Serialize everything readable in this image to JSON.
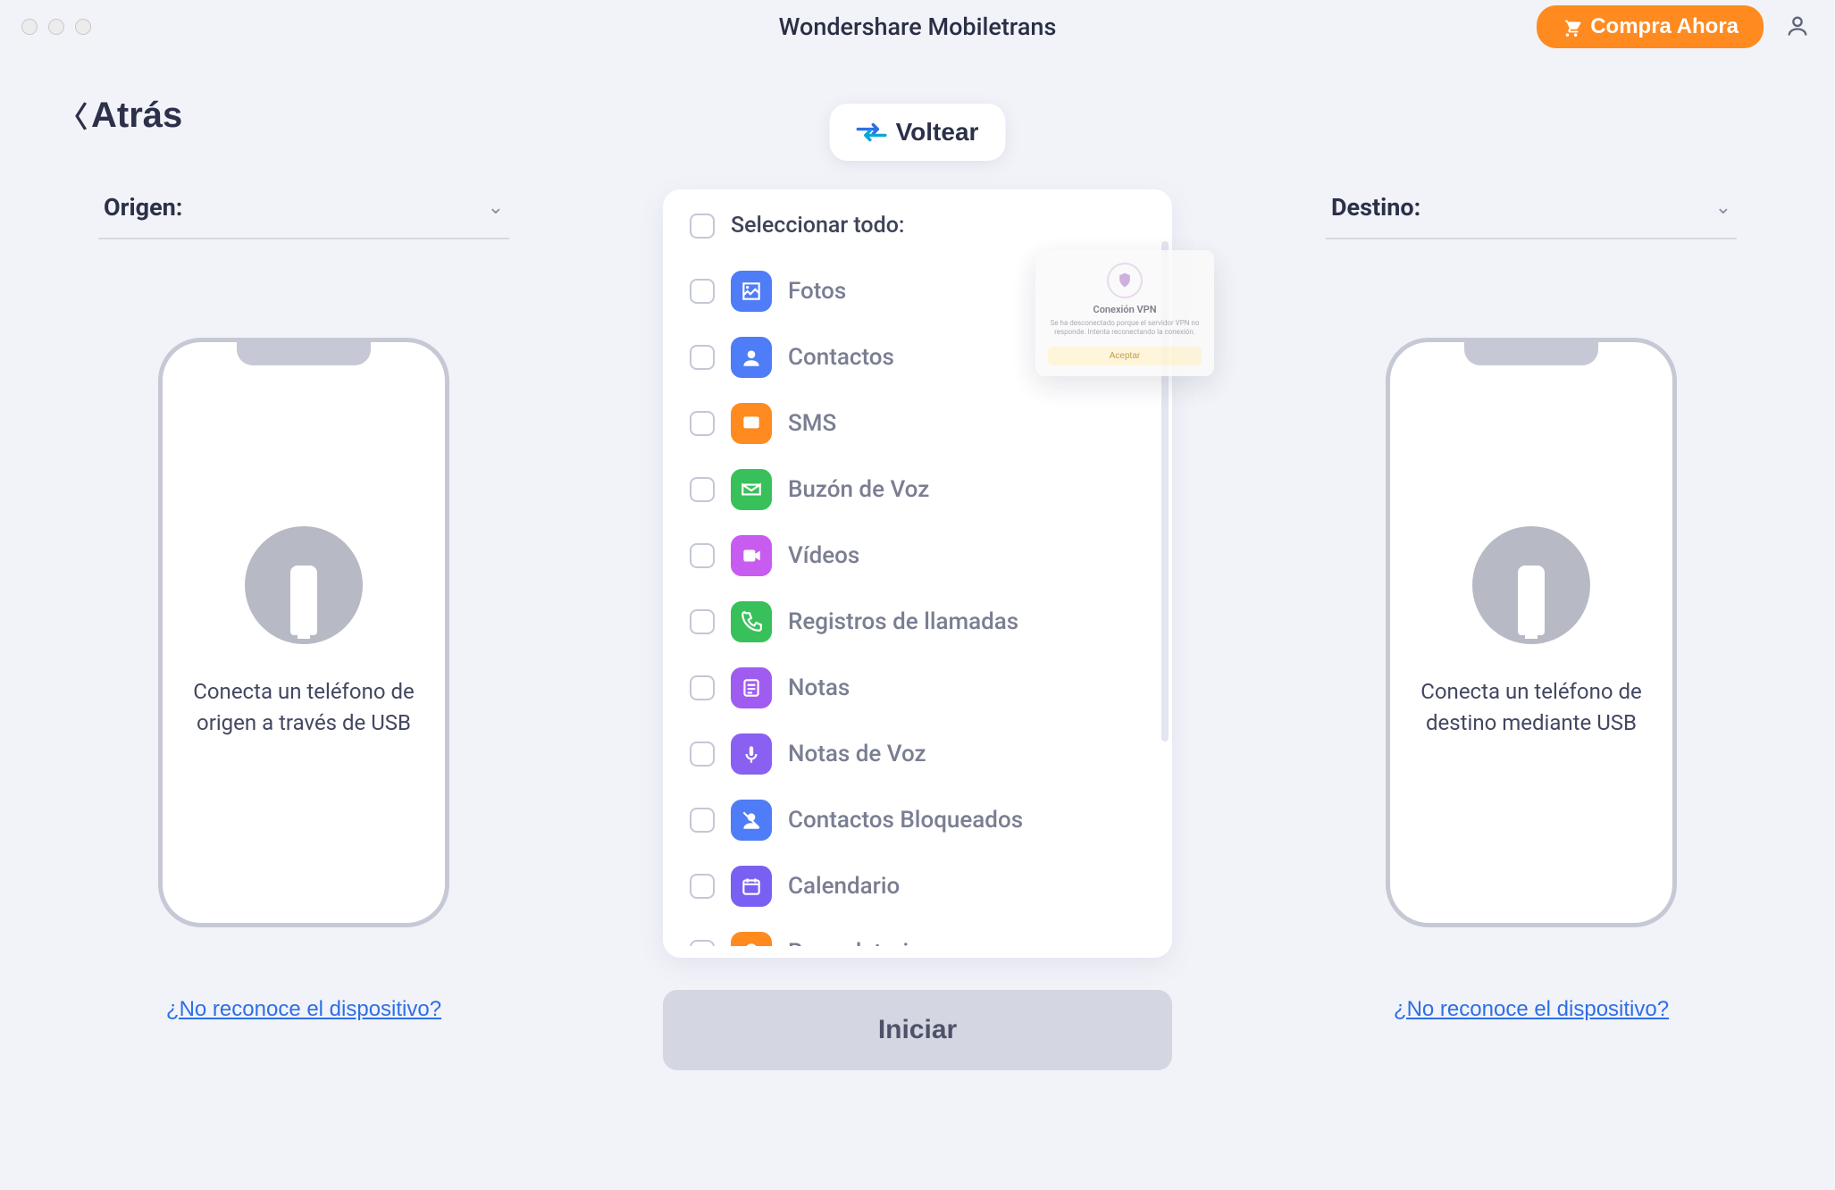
{
  "window": {
    "title": "Wondershare Mobiletrans"
  },
  "header": {
    "buy_label": "Compra Ahora",
    "back_label": "Atrás",
    "flip_label": "Voltear"
  },
  "source": {
    "section_label": "Origen:",
    "hint": "Conecta un teléfono de origen a través de USB",
    "not_recognized": "¿No reconoce el dispositivo?"
  },
  "destination": {
    "section_label": "Destino:",
    "hint": "Conecta un teléfono de destino mediante USB",
    "not_recognized": "¿No reconoce el dispositivo?"
  },
  "data_panel": {
    "select_all_label": "Seleccionar todo:",
    "items": [
      {
        "id": "photos",
        "label": "Fotos",
        "color": "#4f7cf7"
      },
      {
        "id": "contacts",
        "label": "Contactos",
        "color": "#4f7cf7"
      },
      {
        "id": "sms",
        "label": "SMS",
        "color": "#ff8a1f"
      },
      {
        "id": "voicemail",
        "label": "Buzón de Voz",
        "color": "#38c15a"
      },
      {
        "id": "videos",
        "label": "Vídeos",
        "color": "#c85cf0"
      },
      {
        "id": "call-logs",
        "label": "Registros de llamadas",
        "color": "#38c15a"
      },
      {
        "id": "notes",
        "label": "Notas",
        "color": "#a05cf0"
      },
      {
        "id": "voice-notes",
        "label": "Notas de Voz",
        "color": "#8a60f2"
      },
      {
        "id": "blocked-contacts",
        "label": "Contactos Bloqueados",
        "color": "#4f7cf7"
      },
      {
        "id": "calendar",
        "label": "Calendario",
        "color": "#7a60f2"
      },
      {
        "id": "reminders",
        "label": "Recordatorios",
        "color": "#ff8a1f"
      }
    ],
    "start_label": "Iniciar"
  },
  "popup": {
    "title": "Conexión VPN",
    "desc": "Se ha desconectado porque el servidor VPN no responde. Intenta reconectando la conexión.",
    "accept_label": "Aceptar"
  },
  "colors": {
    "accent_orange": "#ff8a1f",
    "accent_blue": "#2d6fe6",
    "text_dark": "#2c3049",
    "text_muted": "#7a7e92"
  }
}
